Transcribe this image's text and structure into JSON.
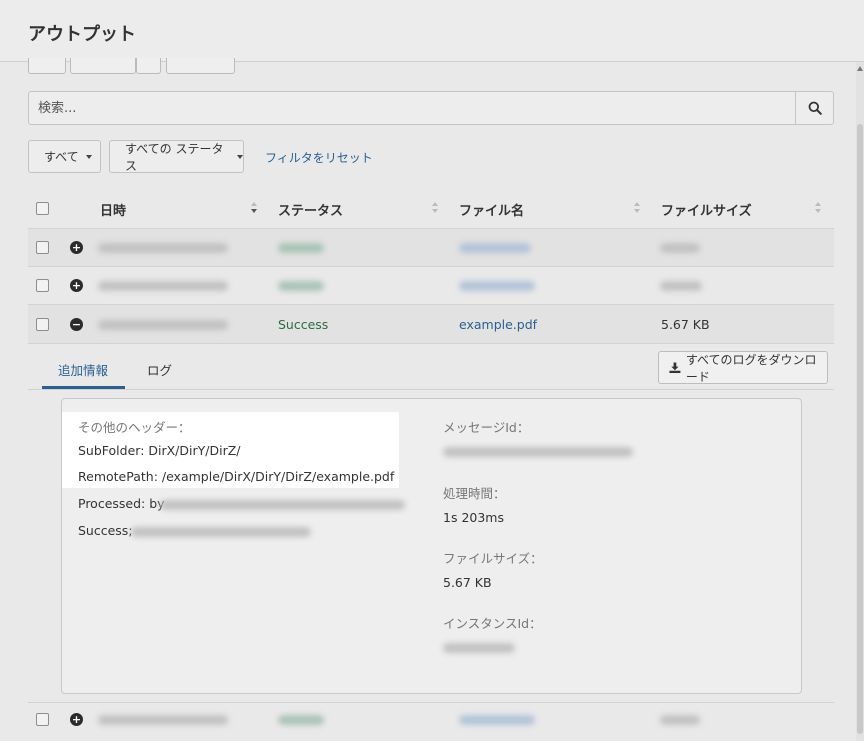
{
  "header": {
    "title": "アウトプット"
  },
  "search": {
    "placeholder": "検索..."
  },
  "filters": {
    "type_label": "すべて",
    "status_label": "すべての ステータス",
    "reset_label": "フィルタをリセット"
  },
  "table": {
    "columns": [
      "日時",
      "ステータス",
      "ファイル名",
      "ファイルサイズ"
    ],
    "expanded_row": {
      "status": "Success",
      "filename": "example.pdf",
      "filesize": "5.67 KB"
    }
  },
  "details": {
    "tabs": [
      "追加情報",
      "ログ"
    ],
    "download_label": "すべてのログをダウンロード",
    "left": {
      "other_headers_label": "その他のヘッダー：",
      "subfolder_line": "SubFolder: DirX/DirY/DirZ/",
      "remotepath_line": "RemotePath: /example/DirX/DirY/DirZ/example.pdf",
      "processed_prefix": "Processed: by",
      "success_prefix": "Success;"
    },
    "right": {
      "message_id_label": "メッセージId：",
      "processing_time_label": "処理時間：",
      "processing_time_value": "1s 203ms",
      "file_size_label": "ファイルサイズ：",
      "file_size_value": "5.67 KB",
      "instance_id_label": "インスタンスId："
    }
  },
  "icons": {
    "search": "search-icon",
    "download": "download-icon",
    "expand": "plus-circle-icon",
    "collapse": "minus-circle-icon"
  },
  "colors": {
    "link": "#2a5f8f",
    "success": "#2e6b3e",
    "highlight": "#ffffff"
  }
}
